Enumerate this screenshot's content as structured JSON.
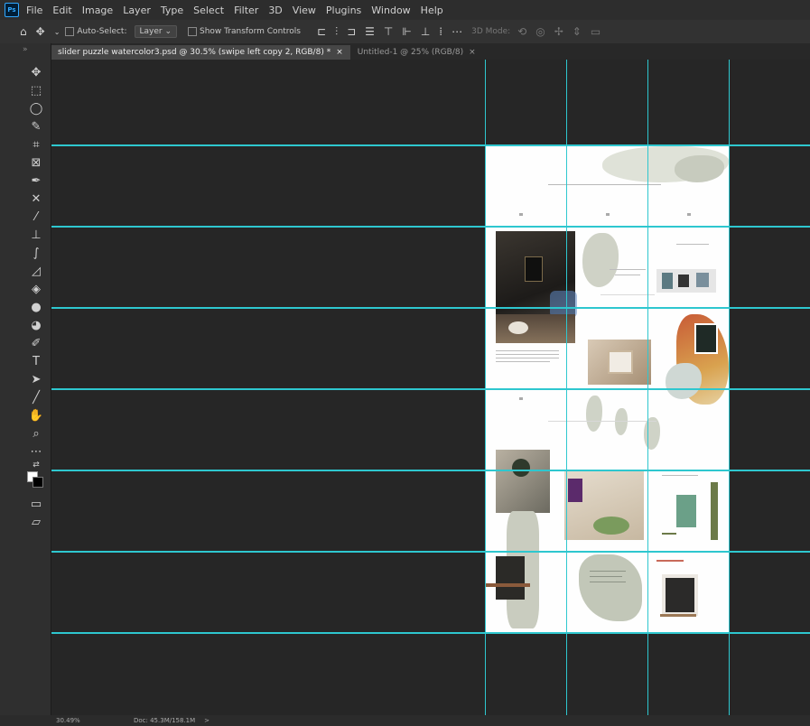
{
  "app": {
    "logo": "Ps"
  },
  "menu": [
    "File",
    "Edit",
    "Image",
    "Layer",
    "Type",
    "Select",
    "Filter",
    "3D",
    "View",
    "Plugins",
    "Window",
    "Help"
  ],
  "options": {
    "auto_select_label": "Auto-Select:",
    "layer_select": "Layer",
    "transform_controls_label": "Show Transform Controls",
    "mode_3d_label": "3D Mode:"
  },
  "tabs": [
    {
      "label": "slider puzzle watercolor3.psd @ 30.5% (swipe left copy 2, RGB/8) *",
      "close": "×"
    },
    {
      "label": "Untitled-1 @ 25% (RGB/8)",
      "close": "×"
    }
  ],
  "status": {
    "zoom": "30.49%",
    "doc": "Doc: 45.3M/158.1M",
    "arrow": ">"
  },
  "icons": {
    "home": "home-icon",
    "move": "move-icon",
    "align": "align-icon"
  },
  "colors": {
    "guide": "#2ec7cf",
    "workspace": "#262626",
    "panel": "#2f2f2f"
  }
}
